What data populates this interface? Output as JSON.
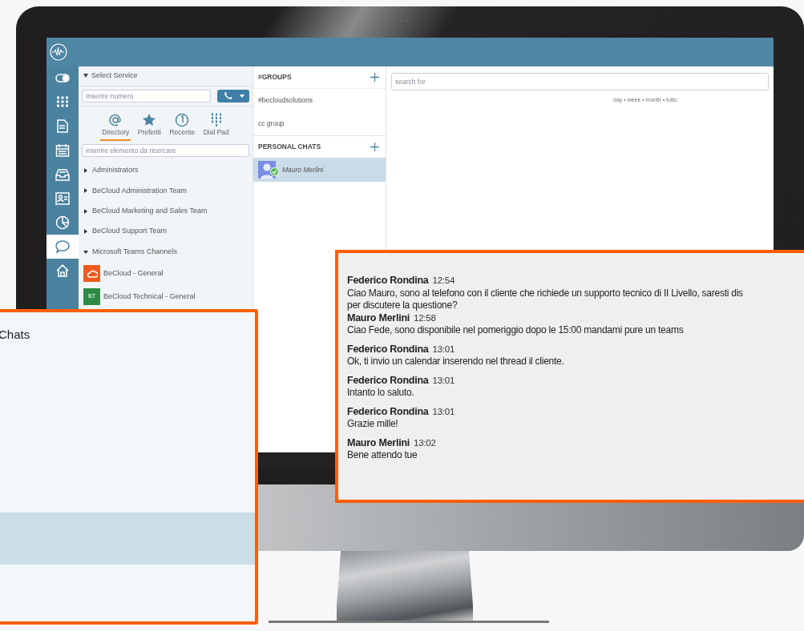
{
  "rail": [
    {
      "kind": "toggle",
      "selected": false
    },
    {
      "kind": "grid",
      "selected": false
    },
    {
      "kind": "document",
      "selected": false
    },
    {
      "kind": "calendar",
      "selected": false
    },
    {
      "kind": "tray",
      "selected": false
    },
    {
      "kind": "contact",
      "selected": false
    },
    {
      "kind": "pie",
      "selected": false
    },
    {
      "kind": "chat",
      "selected": true
    },
    {
      "kind": "home",
      "selected": false
    }
  ],
  "service": {
    "title": "Select Service",
    "number_field": {
      "placeholder": "Inserire numero"
    },
    "tabs": [
      {
        "kind": "at",
        "label": "Directory",
        "selected": true
      },
      {
        "kind": "star",
        "label": "Preferiti",
        "selected": false
      },
      {
        "kind": "clock",
        "label": "Recente",
        "selected": false
      },
      {
        "kind": "dialpad",
        "label": "Dial Pad",
        "selected": false
      }
    ],
    "search": {
      "placeholder": "inserire elemento da ricercare"
    },
    "tree": [
      {
        "label": "Administrators",
        "expanded": false
      },
      {
        "label": "BeCloud Administration Team",
        "expanded": false
      },
      {
        "label": "BeCloud Marketing and Sales Team",
        "expanded": false
      },
      {
        "label": "BeCloud Support Team",
        "expanded": false
      },
      {
        "label": "Microsoft Teams Channels",
        "expanded": true,
        "children": [
          {
            "kind": "cloud",
            "label": "BeCloud - General",
            "color": "#f05a1e"
          },
          {
            "kind": "initials",
            "initials": "BT",
            "label": "BeCloud Technical - General",
            "color": "#2e8b46"
          }
        ]
      }
    ]
  },
  "groups": {
    "title": "#GROUPS",
    "items": [
      {
        "label": "#becloudsolutions"
      },
      {
        "label": "cc group"
      }
    ]
  },
  "personal_chats": {
    "title": "PERSONAL CHATS",
    "items": [
      {
        "name": "Mauro Merlini",
        "selected": true,
        "online": true
      }
    ]
  },
  "conversation": {
    "search": {
      "placeholder": "search for"
    },
    "range_filter": "day • week • month • tutto"
  },
  "chats_callout": {
    "title": "Chats"
  },
  "messages_callout": {
    "messages": [
      {
        "author": "Federico Rondina",
        "time": "12:54",
        "lines": [
          "Ciao Mauro, sono al telefono con il cliente che richiede un supporto tecnico di II Livello, saresti dis",
          "per discutere la questione?"
        ]
      },
      {
        "author": "Mauro Merlini",
        "time": "12:58",
        "lines": [
          "Ciao Fede, sono disponibile nel pomeriggio dopo le 15:00 mandami pure un teams"
        ]
      },
      {
        "author": "Federico Rondina",
        "time": "13:01",
        "lines": [
          "Ok, ti invio un calendar inserendo nel thread il cliente."
        ]
      },
      {
        "author": "Federico Rondina",
        "time": "13:01",
        "lines": [
          "Intanto lo saluto."
        ]
      },
      {
        "author": "Federico Rondina",
        "time": "13:01",
        "lines": [
          "Grazie mille!"
        ]
      },
      {
        "author": "Mauro Merlini",
        "time": "13:02",
        "lines": [
          "Bene attendo tue"
        ]
      }
    ]
  }
}
